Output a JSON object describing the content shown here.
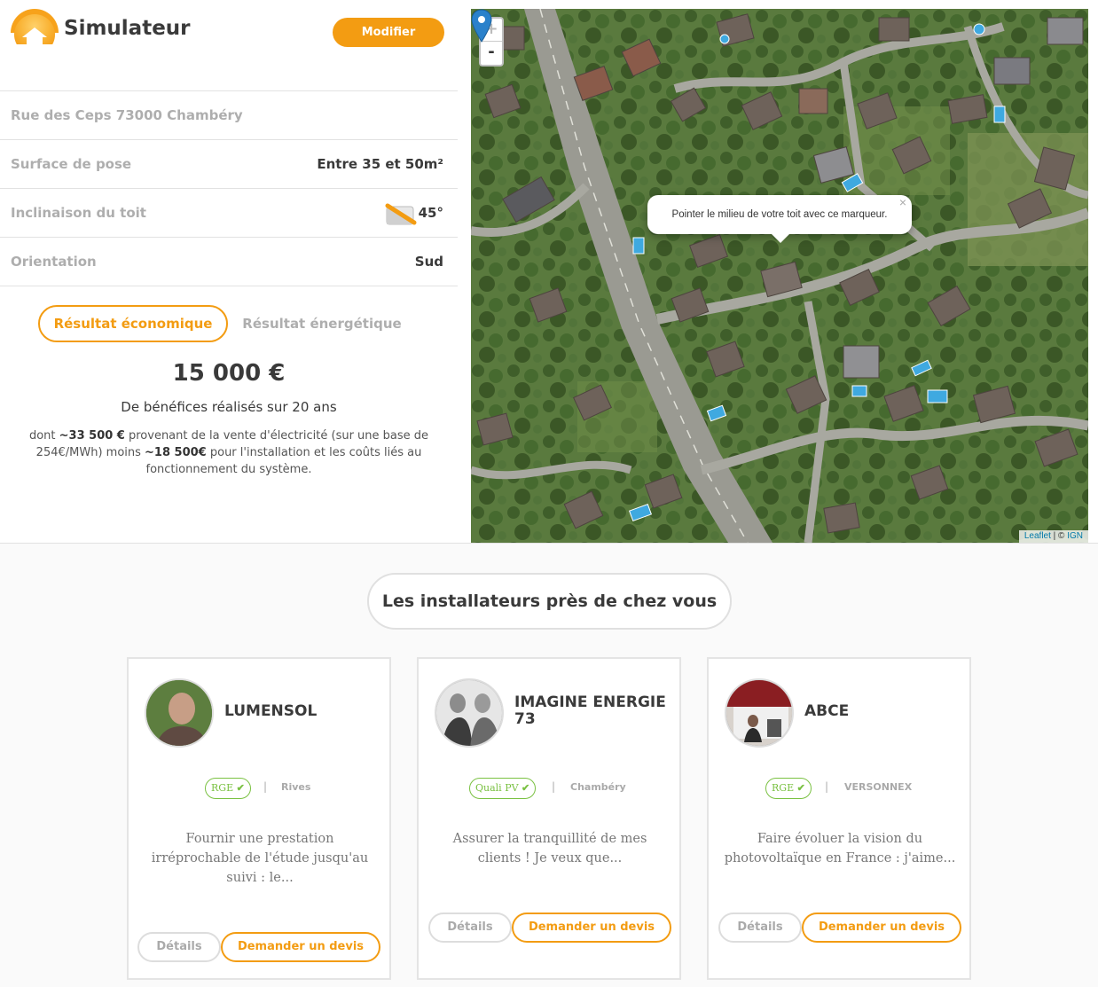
{
  "header": {
    "title": "Simulateur",
    "modify_button": "Modifier"
  },
  "info": {
    "address": "Rue des Ceps 73000 Chambéry",
    "rows": [
      {
        "label": "Surface de pose",
        "value": "Entre 35 et 50m²"
      },
      {
        "label": "Inclinaison du toit",
        "value": "45°"
      },
      {
        "label": "Orientation",
        "value": "Sud"
      }
    ]
  },
  "tabs": {
    "economic": "Résultat économique",
    "energetic": "Résultat énergétique",
    "active": "economic"
  },
  "result": {
    "amount": "15 000 €",
    "benefit_text": "De bénéfices réalisés sur 20 ans",
    "detail_prefix": "dont ",
    "detail_amount1": "~33 500 €",
    "detail_mid": " provenant de la vente d'électricité (sur une base de 254€/MWh) moins ",
    "detail_amount2": "~18 500€",
    "detail_suffix": " pour l'installation et les coûts liés au fonctionnement du système."
  },
  "map": {
    "zoom_in": "+",
    "zoom_out": "-",
    "popup_text": "Pointer le milieu de votre toit avec ce marqueur.",
    "popup_close": "×",
    "attribution_leaflet": "Leaflet",
    "attribution_sep": " | © ",
    "attribution_ign": "IGN"
  },
  "installers_section": {
    "title": "Les installateurs près de chez vous",
    "details_button": "Détails",
    "quote_button": "Demander un devis",
    "separator": "|",
    "check_icon": "✔",
    "cards": [
      {
        "name": "LUMENSOL",
        "badge": "RGE",
        "city": "Rives",
        "description": "Fournir une prestation irréprochable de l'étude jusqu'au suivi : le..."
      },
      {
        "name": "IMAGINE ENERGIE 73",
        "badge": "Quali PV",
        "city": "Chambéry",
        "description": "Assurer la tranquillité de mes clients ! Je veux que..."
      },
      {
        "name": "ABCE",
        "badge": "RGE",
        "city": "VERSONNEX",
        "description": "Faire évoluer la vision du photovoltaïque en France : j'aime..."
      }
    ]
  },
  "colors": {
    "accent": "#f39c12",
    "badge_green": "#7ac142",
    "muted": "#aeaeae"
  }
}
